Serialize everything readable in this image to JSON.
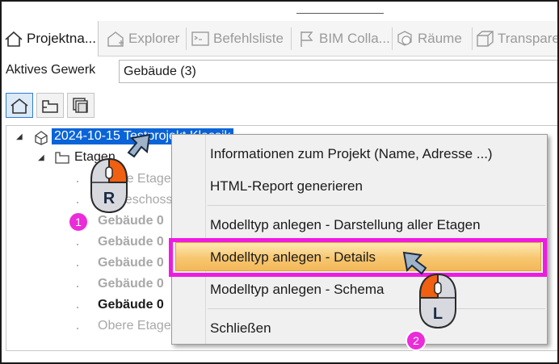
{
  "tabs": [
    {
      "label": "Projektna...",
      "icon": "house-icon",
      "active": true
    },
    {
      "label": "Explorer",
      "icon": "house-outline-icon",
      "active": false
    },
    {
      "label": "Befehlsliste",
      "icon": "command-list-icon",
      "active": false
    },
    {
      "label": "BIM Colla...",
      "icon": "flag-icon",
      "active": false
    },
    {
      "label": "Räume",
      "icon": "rooms-icon",
      "active": false
    },
    {
      "label": "Transpare",
      "icon": "cube-icon",
      "active": false
    }
  ],
  "gewerk": {
    "label": "Aktives Gewerk",
    "value": "Gebäude (3)"
  },
  "tree": {
    "project": "2024-10-15 Testprojekt Klassik",
    "etagen": "Etagen",
    "items": [
      "Obere Etage",
      "Erdgeschoss",
      "Gebäude 0",
      "Gebäude 0",
      "Gebäude 0",
      "Gebäude 0",
      "Gebäude 0",
      "Obere Etage"
    ]
  },
  "menu": {
    "items": [
      "Informationen zum Projekt (Name, Adresse ...)",
      "HTML-Report generieren",
      "Modelltyp anlegen - Darstellung aller Etagen",
      "Modelltyp anlegen - Details",
      "Modelltyp anlegen - Schema",
      "Schließen"
    ]
  },
  "annotations": {
    "step1": "1",
    "step2": "2",
    "right_mouse_letter": "R",
    "left_mouse_letter": "L",
    "badge_color": "#ea2cd9",
    "highlight_color": "#ee1be0",
    "selection_color": "#0a64d8",
    "mouse_button_color": "#f06010"
  }
}
